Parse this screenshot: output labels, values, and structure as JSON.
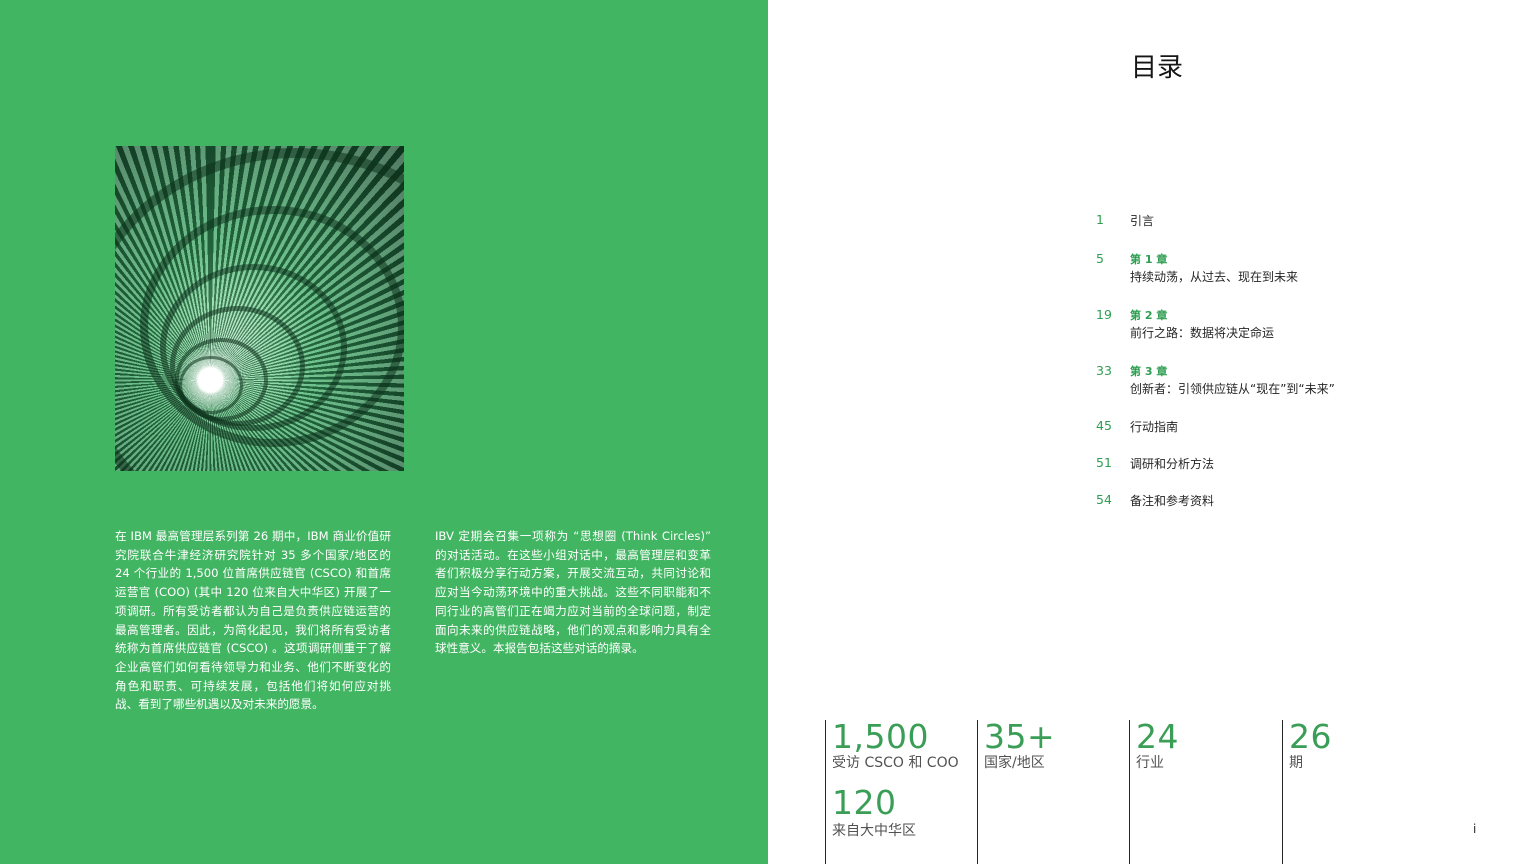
{
  "intro": {
    "paragraph_1": "在 IBM 最高管理层系列第 26 期中，IBM 商业价值研究院联合牛津经济研究院针对 35 多个国家/地区的 24 个行业的 1,500 位首席供应链官 (CSCO) 和首席运营官 (COO) (其中 120 位来自大中华区) 开展了一项调研。所有受访者都认为自己是负责供应链运营的最高管理者。因此，为简化起见，我们将所有受访者统称为首席供应链官 (CSCO) 。这项调研侧重于了解企业高管们如何看待领导力和业务、他们不断变化的角色和职责、可持续发展，包括他们将如何应对挑战、看到了哪些机遇以及对未来的愿景。",
    "paragraph_2": "IBV 定期会召集一项称为 “思想圈 (Think Circles)” 的对话活动。在这些小组对话中，最高管理层和变革者们积极分享行动方案，开展交流互动，共同讨论和应对当今动荡环境中的重大挑战。这些不同职能和不同行业的高管们正在竭力应对当前的全球问题，制定面向未来的供应链战略，他们的观点和影响力具有全球性意义。本报告包括这些对话的摘录。"
  },
  "toc": {
    "title": "目录",
    "entries": [
      {
        "page": "1",
        "chapter": "",
        "label": "引言"
      },
      {
        "page": "5",
        "chapter": "第 1 章",
        "label": "持续动荡，从过去、现在到未来"
      },
      {
        "page": "19",
        "chapter": "第 2 章",
        "label": "前行之路：数据将决定命运"
      },
      {
        "page": "33",
        "chapter": "第 3 章",
        "label": "创新者：引领供应链从“现在”到“未来”"
      },
      {
        "page": "45",
        "chapter": "",
        "label": "行动指南"
      },
      {
        "page": "51",
        "chapter": "",
        "label": "调研和分析方法"
      },
      {
        "page": "54",
        "chapter": "",
        "label": "备注和参考资料"
      }
    ]
  },
  "stats": [
    {
      "value": "1,500",
      "label": "受访 CSCO 和 COO",
      "value_2": "120",
      "label_2": "来自大中华区"
    },
    {
      "value": "35+",
      "label": "国家/地区"
    },
    {
      "value": "24",
      "label": "行业"
    },
    {
      "value": "26",
      "label": "期"
    }
  ],
  "footer": {
    "page_number": "i"
  },
  "colors": {
    "panel_green": "#42b563",
    "accent_green": "#2e9e52",
    "text_dark": "#161616"
  }
}
